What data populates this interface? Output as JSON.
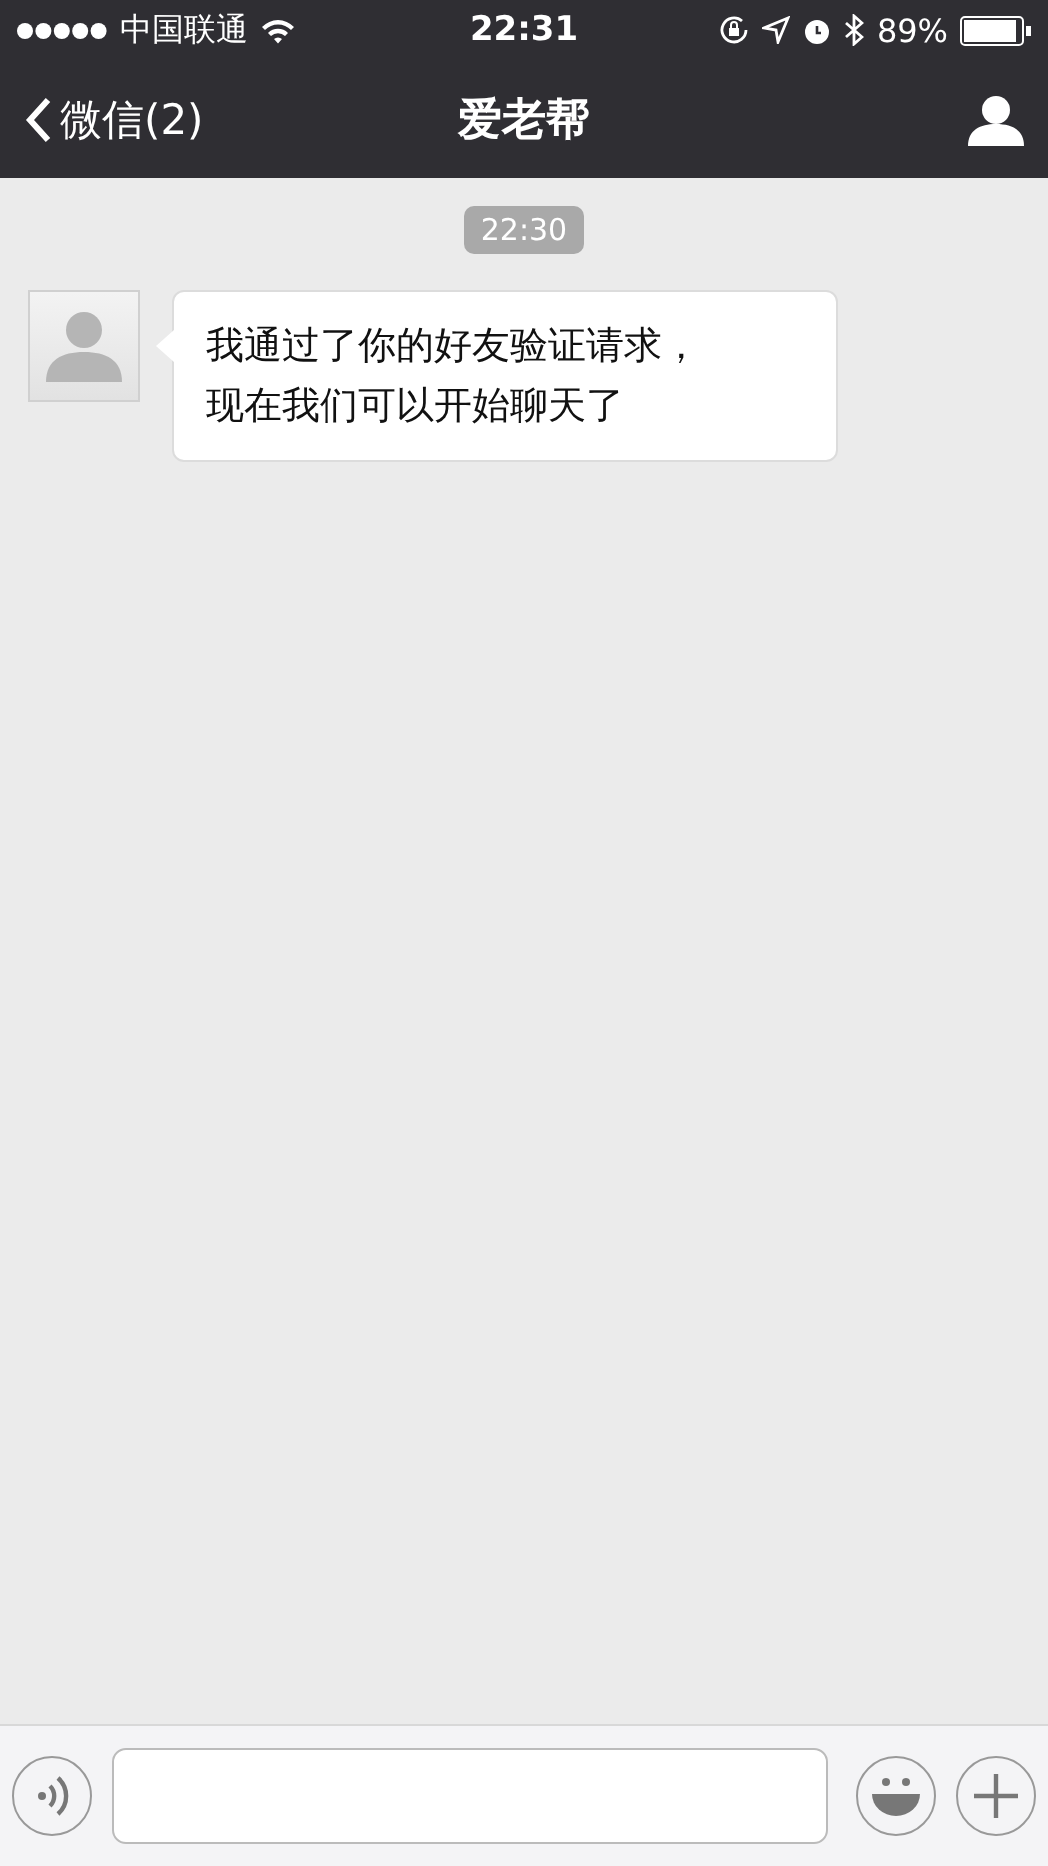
{
  "status_bar": {
    "carrier": "中国联通",
    "time": "22:31",
    "battery_text": "89%"
  },
  "nav": {
    "back_label": "微信(2)",
    "title": "爱老帮"
  },
  "messages": [
    {
      "kind": "timestamp",
      "text": "22:30"
    },
    {
      "kind": "incoming",
      "text": "我通过了你的好友验证请求，现在我们可以开始聊天了"
    }
  ]
}
